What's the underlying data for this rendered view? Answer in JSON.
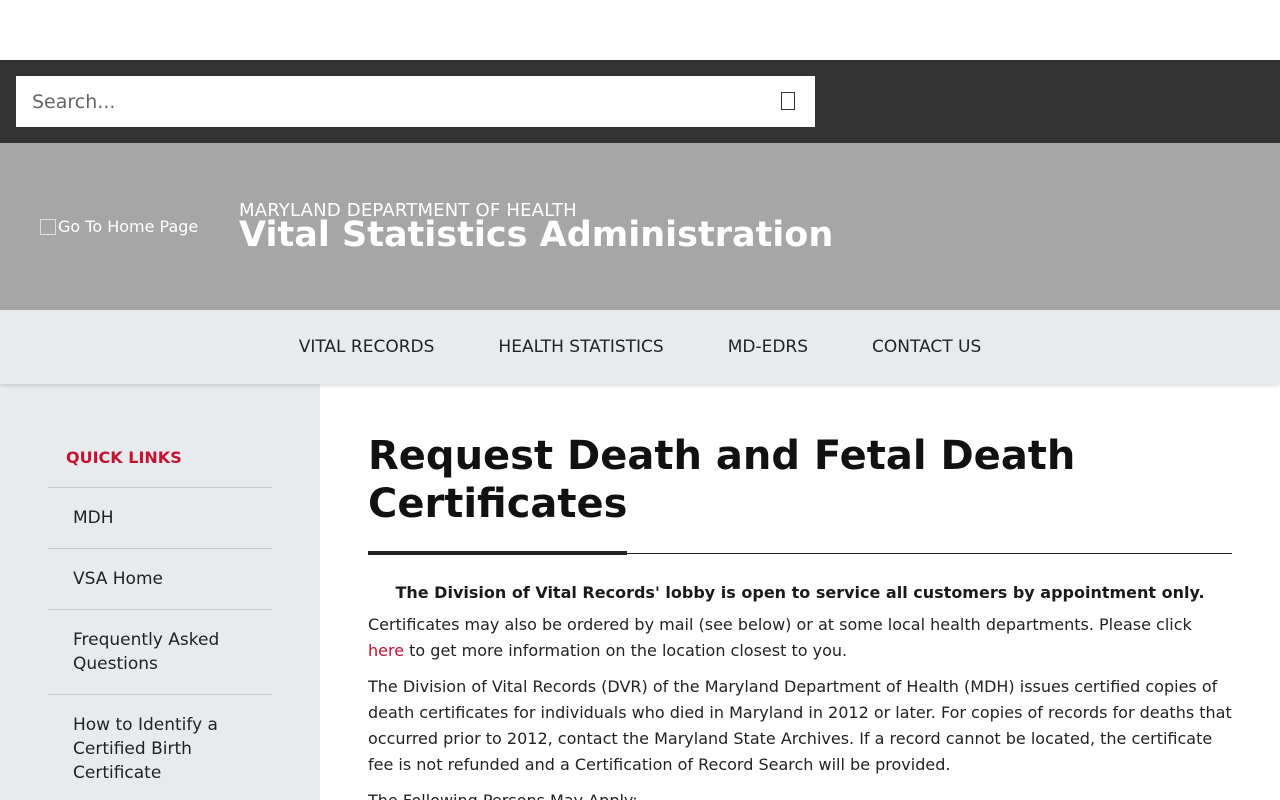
{
  "search": {
    "placeholder": "Search...",
    "button_icon": "search-icon"
  },
  "header": {
    "logo_alt": "Go To Home Page",
    "department": "MARYLAND DEPARTMENT OF HEALTH",
    "agency": "Vital Statistics Administration"
  },
  "nav": {
    "items": [
      "VITAL RECORDS",
      "HEALTH STATISTICS",
      "MD-EDRS",
      "CONTACT US"
    ]
  },
  "sidebar": {
    "title": "QUICK LINKS",
    "items": [
      "MDH",
      "VSA Home",
      "Frequently Asked Questions",
      "How to Identify a Certified Birth Certificate"
    ]
  },
  "main": {
    "title": "Request Death and Fetal Death Certificates",
    "notice": "The Division of Vital Records' lobby is open to service all customers by appointment only.",
    "para1_before": "Certificates may also be ordered by mail (see below) or at some local health departments. Please click ",
    "para1_link": "here",
    "para1_after": " to get more information on the location closest to you.",
    "para2": "The Division of Vital Records (DVR) of the Maryland Department of Health (MDH) issues certified copies of death certificates for individuals who died in Maryland in 2012 or later. For copies of records for deaths that occurred prior to 2012, contact the Maryland State Archives. If a record cannot be located, the certificate fee is not refunded and a Certification of Record Search will be provided.",
    "para3": "The Following Persons May Apply:"
  },
  "colors": {
    "accent": "#c41230",
    "search_bar": "#333333",
    "banner": "#a6a6a6",
    "nav_bg": "#e8ebee"
  }
}
